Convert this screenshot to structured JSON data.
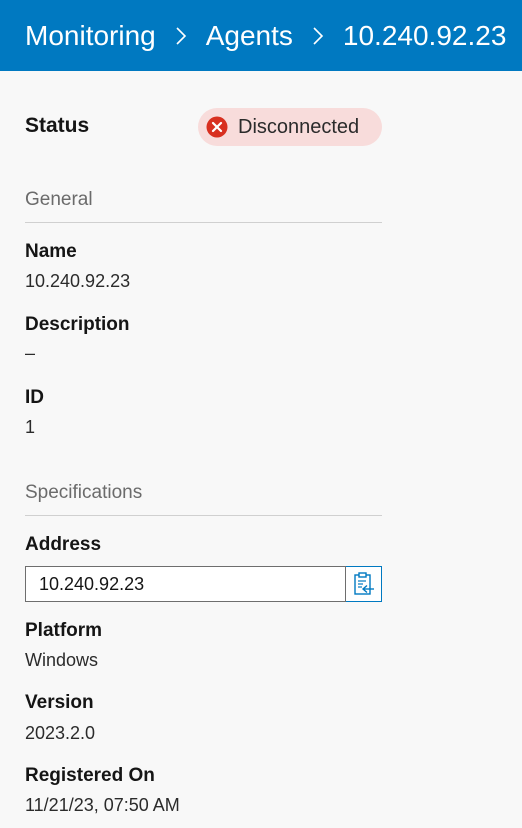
{
  "breadcrumb": {
    "items": [
      "Monitoring",
      "Agents",
      "10.240.92.23"
    ]
  },
  "status": {
    "label": "Status",
    "badge_text": "Disconnected",
    "badge_color": "#d83020",
    "badge_background": "#f8dcdb",
    "icon": "x-circle-icon"
  },
  "general": {
    "title": "General",
    "fields": [
      {
        "label": "Name",
        "value": "10.240.92.23"
      },
      {
        "label": "Description",
        "value": "–"
      },
      {
        "label": "ID",
        "value": "1"
      }
    ]
  },
  "specifications": {
    "title": "Specifications",
    "address": {
      "label": "Address",
      "value": "10.240.92.23",
      "copy_icon": "clipboard-copy-icon"
    },
    "fields": [
      {
        "label": "Platform",
        "value": "Windows"
      },
      {
        "label": "Version",
        "value": "2023.2.0"
      },
      {
        "label": "Registered On",
        "value": "11/21/23, 07:50 AM"
      }
    ]
  },
  "colors": {
    "header": "#0079c1",
    "background": "#f8f8f8"
  }
}
